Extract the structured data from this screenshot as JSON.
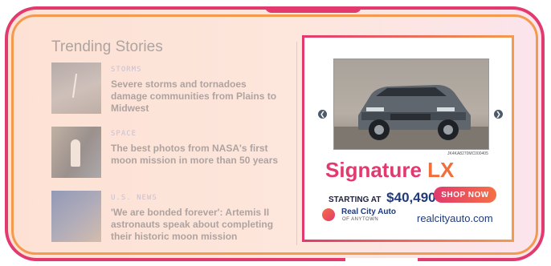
{
  "trending": {
    "title": "Trending Stories",
    "stories": [
      {
        "category": "STORMS",
        "headline": "Severe storms and tornadoes damage communities from Plains to Midwest"
      },
      {
        "category": "SPACE",
        "headline": "The best photos from NASA's first moon mission in more than 50 years"
      },
      {
        "category": "U.S. NEWS",
        "headline": "'We are bonded forever': Artemis II astronauts speak about completing their historic moon mission"
      }
    ]
  },
  "ad": {
    "vin": "JK4KA8270MC000405",
    "model_name": "Signature",
    "model_trim": "LX",
    "starting_label": "STARTING AT",
    "price": "$40,490",
    "shop_button": "SHOP NOW",
    "dealer_name": "Real City Auto",
    "dealer_location": "OF ANYTOWN",
    "dealer_url": "realcityauto.com",
    "prev_icon": "chevron-left-icon",
    "next_icon": "chevron-right-icon",
    "colors": {
      "accent_pink": "#e23a6e",
      "accent_orange": "#f39a4e",
      "navy": "#1f3b7a"
    }
  }
}
